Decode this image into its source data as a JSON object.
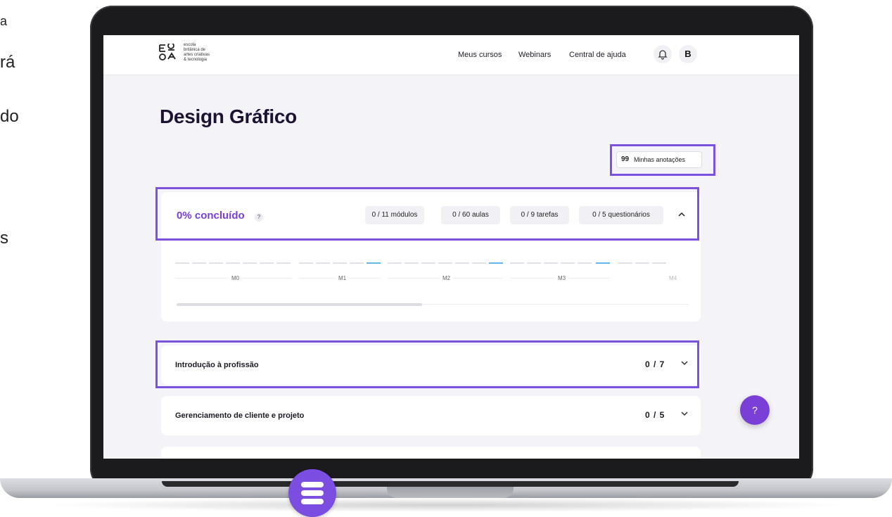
{
  "side_text": [
    "a",
    "rá",
    "do",
    "s"
  ],
  "header": {
    "logo_lines": [
      "escola",
      "britânica de",
      "artes criativas",
      "& tecnologia"
    ],
    "nav": [
      "Meus cursos",
      "Webinars",
      "Central de ajuda"
    ],
    "avatar_letter": "B"
  },
  "page": {
    "title": "Design Gráfico",
    "notes_icon": "99",
    "notes_label": "Minhas anotações"
  },
  "progress": {
    "percent_label": "0% concluído",
    "help": "?",
    "chips": [
      "0 / 11 módulos",
      "0 / 60 aulas",
      "0 / 9 tarefas",
      "0 / 5 questionários"
    ],
    "chevron": "^",
    "modules": [
      "M0",
      "M1",
      "M2",
      "M3",
      "M4"
    ],
    "completion_fraction": 0
  },
  "modules": [
    {
      "title": "Introdução à profissão",
      "count": "0 / 7"
    },
    {
      "title": "Gerenciamento de cliente e projeto",
      "count": "0 / 5"
    }
  ],
  "fab_label": "?",
  "colors": {
    "accent": "#7a3fd6",
    "highlight": "#7a52df",
    "timeline_marker": "#62b6ea"
  }
}
